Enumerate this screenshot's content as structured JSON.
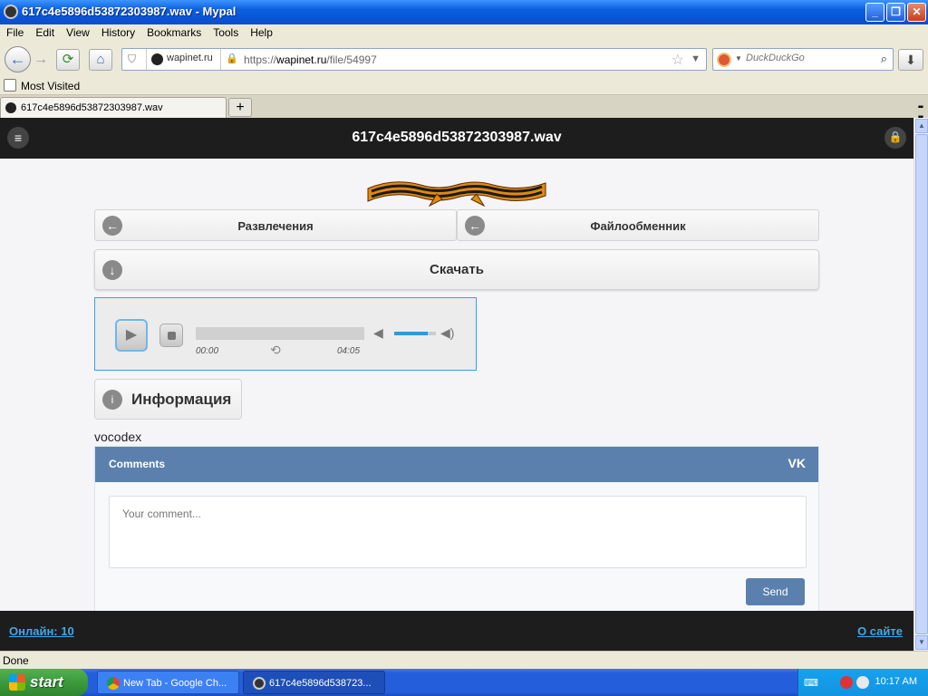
{
  "window": {
    "title": "617c4e5896d53872303987.wav - Mypal",
    "minimize": "_",
    "maximize": "❐",
    "close": "✕"
  },
  "menu": [
    "File",
    "Edit",
    "View",
    "History",
    "Bookmarks",
    "Tools",
    "Help"
  ],
  "nav": {
    "site_identity": "wapinet.ru",
    "url_prefix": "https://",
    "url_domain": "wapinet.ru",
    "url_path": "/file/54997",
    "search_placeholder": "DuckDuckGo"
  },
  "bookmarks": {
    "most_visited": "Most Visited"
  },
  "tab": {
    "title": "617c4e5896d53872303987.wav"
  },
  "page": {
    "title": "617c4e5896d53872303987.wav",
    "categories": [
      "Развлечения",
      "Файлообменник"
    ],
    "download_label": "Скачать",
    "player": {
      "current_time": "00:00",
      "total_time": "04:05",
      "progress": 0,
      "volume": 0.8
    },
    "info_label": "Информация",
    "author": "vocodex",
    "comments": {
      "title": "Comments",
      "brand": "VK",
      "placeholder": "Your comment...",
      "send": "Send"
    },
    "footer": {
      "online": "Онлайн: 10",
      "about": "О сайте"
    }
  },
  "status": "Done",
  "taskbar": {
    "start": "start",
    "tasks": [
      "New Tab - Google Ch...",
      "617c4e5896d538723..."
    ],
    "clock": "10:17 AM"
  },
  "colors": {
    "titlebar": "#0a5fe0",
    "site_header": "#1d1d1d",
    "accent_link": "#3fa9e6",
    "vk_blue": "#5b80ad",
    "player_border": "#39a1e0"
  }
}
